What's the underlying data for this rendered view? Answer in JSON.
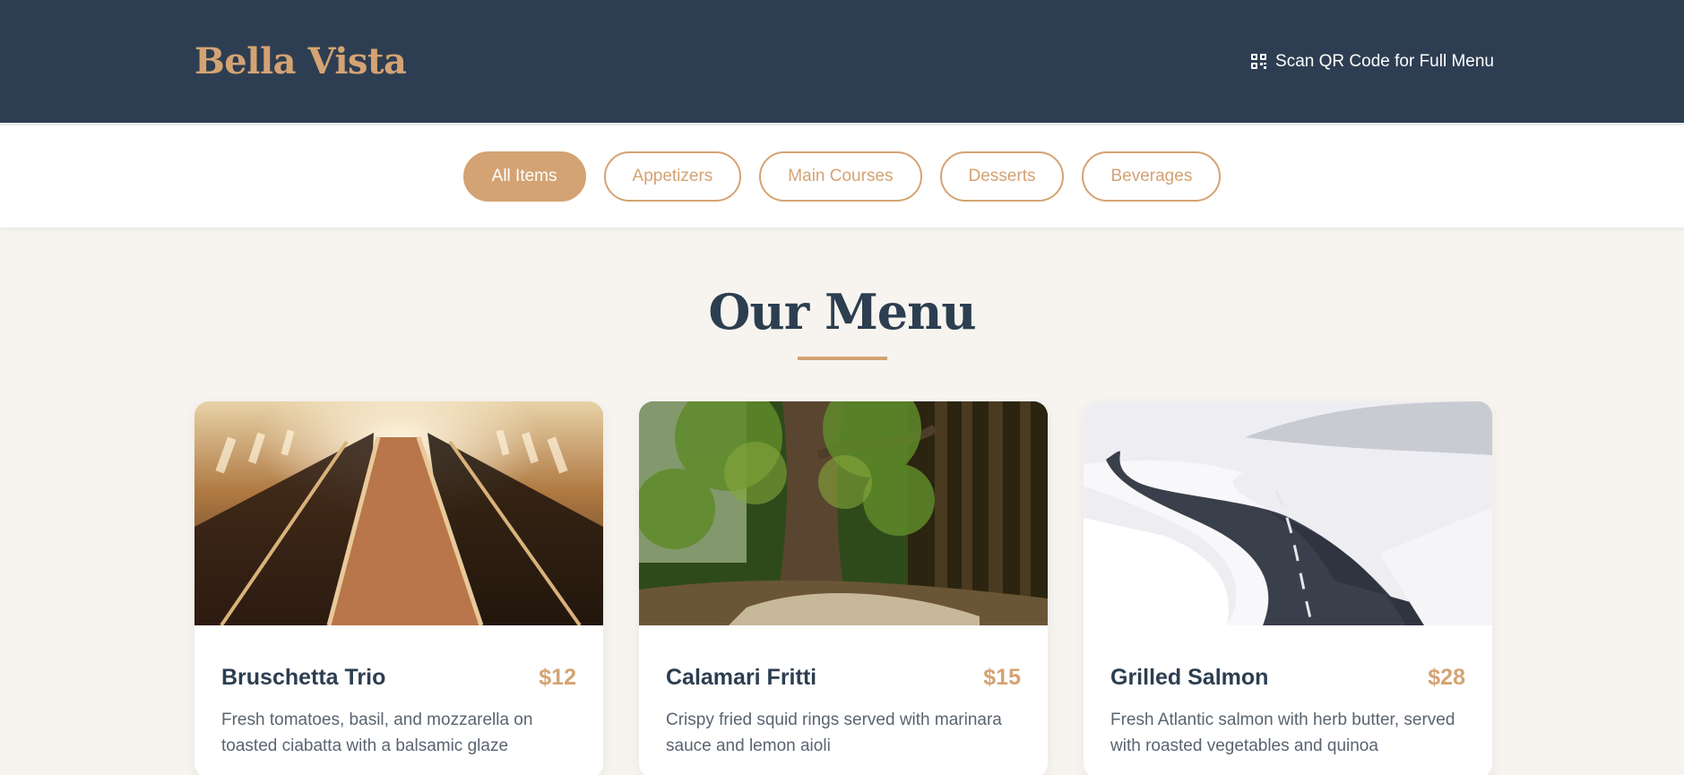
{
  "header": {
    "brand": "Bella Vista",
    "scan_label": "Scan QR Code for Full Menu",
    "scan_icon": "qr-code-icon"
  },
  "filters": [
    {
      "label": "All Items",
      "active": true
    },
    {
      "label": "Appetizers",
      "active": false
    },
    {
      "label": "Main Courses",
      "active": false
    },
    {
      "label": "Desserts",
      "active": false
    },
    {
      "label": "Beverages",
      "active": false
    }
  ],
  "menu": {
    "title": "Our Menu",
    "items": [
      {
        "name": "Bruschetta Trio",
        "price": "$12",
        "description": "Fresh tomatoes, basil, and mozzarella on toasted ciabatta with a balsamic glaze"
      },
      {
        "name": "Calamari Fritti",
        "price": "$15",
        "description": "Crispy fried squid rings served with marinara sauce and lemon aioli"
      },
      {
        "name": "Grilled Salmon",
        "price": "$28",
        "description": "Fresh Atlantic salmon with herb butter, served with roasted vegetables and quinoa"
      }
    ]
  },
  "colors": {
    "header_bg": "#2e3e52",
    "accent": "#d4a373",
    "page_bg": "#f7f4ef"
  }
}
